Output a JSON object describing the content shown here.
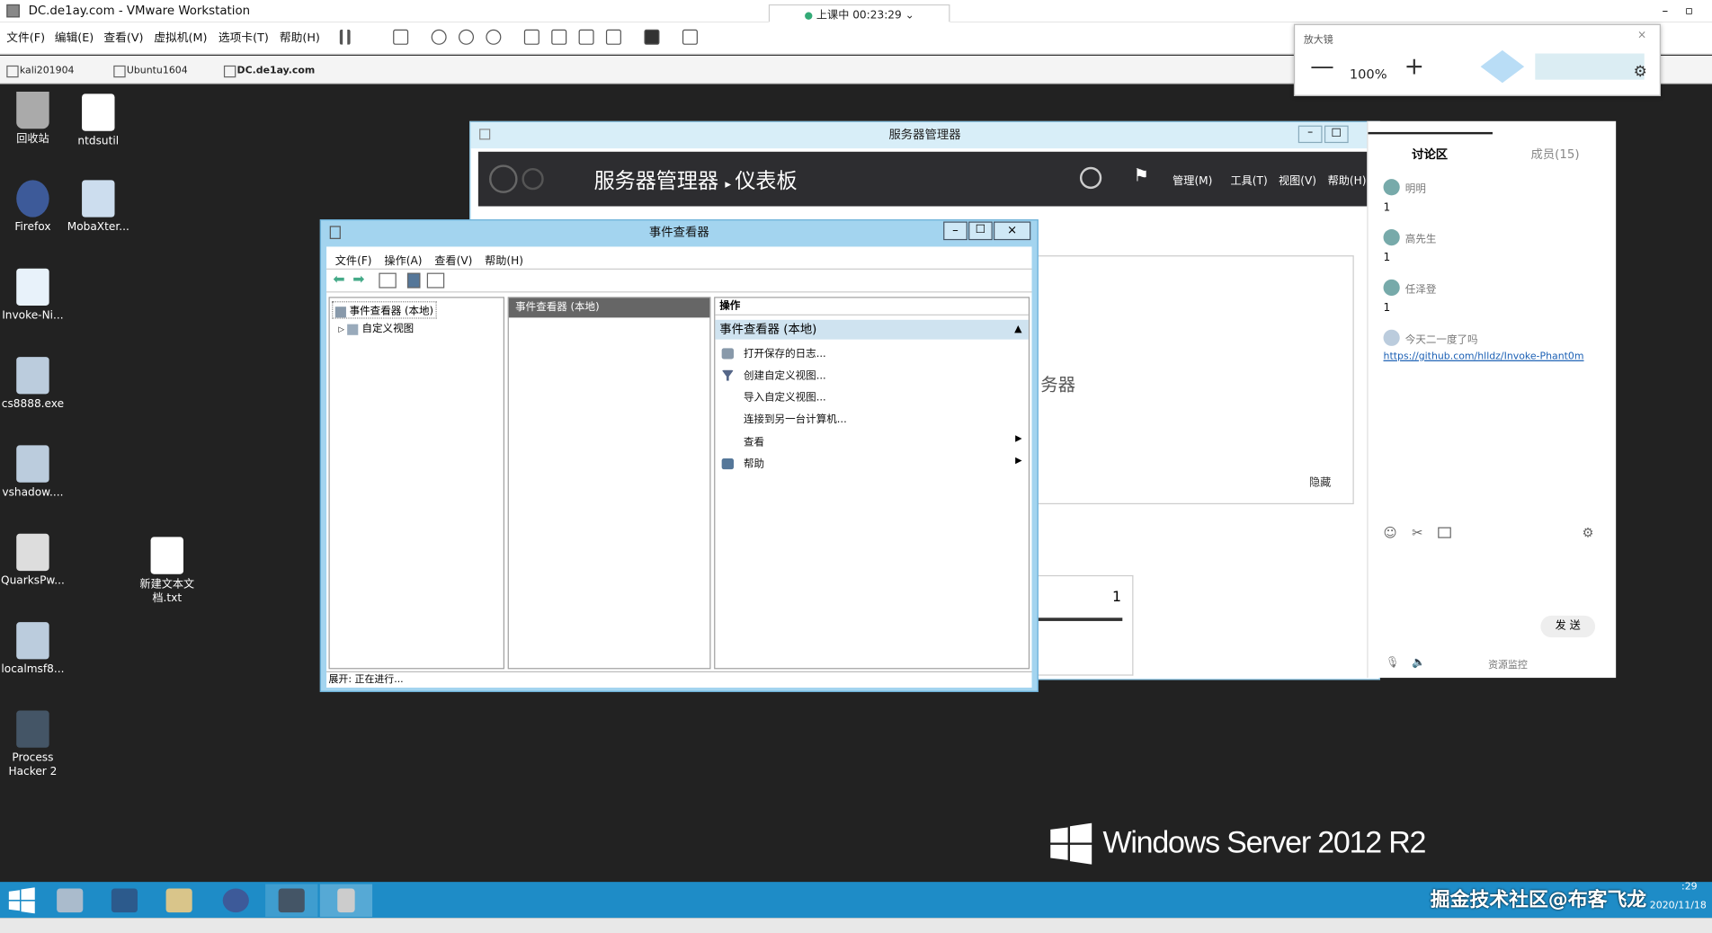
{
  "vmware": {
    "title": "DC.de1ay.com - VMware Workstation",
    "menu": [
      "文件(F)",
      "编辑(E)",
      "查看(V)",
      "虚拟机(M)",
      "选项卡(T)",
      "帮助(H)"
    ],
    "tabs": [
      "kali201904",
      "Ubuntu1604",
      "DC.de1ay.com"
    ],
    "timer": "上课中 00:23:29"
  },
  "magnifier": {
    "title": "放大镜",
    "zoom": "100%",
    "minus": "—",
    "plus": "+"
  },
  "desktop": {
    "icons": [
      "回收站",
      "ntdsutil",
      "Firefox",
      "MobaXter...",
      "Invoke-Ni...",
      "cs8888.exe",
      "vshadow....",
      "QuarksPw...",
      "新建文本文档.txt",
      "localmsf8...",
      "Process Hacker 2"
    ],
    "brand": "Windows Server 2012 R2",
    "watermark": "掘金技术社区@布客飞龙",
    "time": ":29",
    "date": "2020/11/18"
  },
  "server_manager": {
    "title": "服务器管理器",
    "crumb1": "服务器管理器",
    "crumb2": "仪表板",
    "menu": [
      "管理(M)",
      "工具(T)",
      "视图(V)",
      "帮助(H)"
    ],
    "partial": "务器",
    "hide": "隐藏",
    "count": "1"
  },
  "event_viewer": {
    "title": "事件查看器",
    "menu": [
      "文件(F)",
      "操作(A)",
      "查看(V)",
      "帮助(H)"
    ],
    "tree_root": "事件查看器 (本地)",
    "tree_child": "自定义视图",
    "middle_header": "事件查看器 (本地)",
    "actions_header": "操作",
    "actions_section": "事件查看器 (本地)",
    "actions": [
      "打开保存的日志...",
      "创建自定义视图...",
      "导入自定义视图...",
      "连接到另一台计算机...",
      "查看",
      "帮助"
    ],
    "status": "展开:  正在进行..."
  },
  "chat": {
    "tab_discuss": "讨论区",
    "tab_members": "成员(15)",
    "messages": [
      {
        "name": "明明",
        "text": "1"
      },
      {
        "name": "高先生",
        "text": "1"
      },
      {
        "name": "任泽登",
        "text": "1"
      },
      {
        "name": "今天二一度了吗",
        "text": "https://github.com/hlldz/Invoke-Phant0m"
      }
    ],
    "send": "发 送",
    "monitor": "资源监控"
  },
  "colors": {
    "taskbar": "#1e8cc7",
    "sm_bar": "#2d2d30",
    "ev_frame": "#a3d4ef"
  }
}
